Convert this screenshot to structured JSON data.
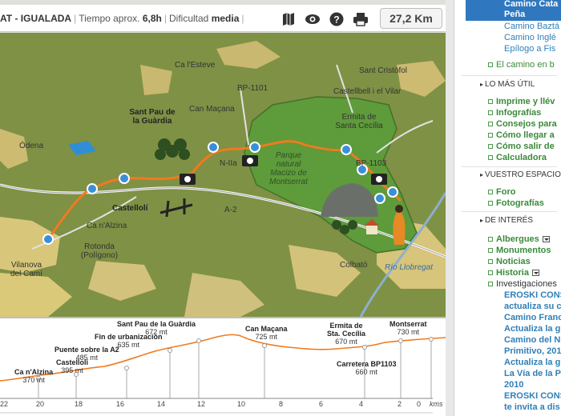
{
  "header": {
    "route_name": "AT - IGUALADA",
    "time_label": "Tiempo aprox.",
    "time_value": "6,8h",
    "difficulty_label": "Dificultad",
    "difficulty_value": "media",
    "distance": "27,2 Km",
    "icons": [
      "map-icon",
      "eye-icon",
      "help-icon",
      "print-icon"
    ]
  },
  "map": {
    "towns": [
      "Ca l'Esteve",
      "BP-1101",
      "Sant Cristòfol",
      "Castellbell i el Vilar",
      "Ermita de Santa Cecília",
      "Sant Pau de la Guàrdia",
      "Can Maçana",
      "Ódena",
      "BP-1103",
      "Castellolí",
      "N-IIa",
      "Ca n'Alzina",
      "Rotonda (Polígono)",
      "A-2",
      "Vilanova del Camí",
      "Colbató",
      "Río Llobregat"
    ],
    "park_label": "Parque natural Macizo de Montserrat"
  },
  "elevation": {
    "points": [
      {
        "name": "Ca n'Alzina",
        "alt": "370 mt"
      },
      {
        "name": "Castellolí",
        "alt": "395 mt"
      },
      {
        "name": "Puente sobre la A2",
        "alt": "485 mt"
      },
      {
        "name": "Fin de urbanización",
        "alt": "635 mt"
      },
      {
        "name": "Sant Pau de la Guàrdia",
        "alt": "672 mt"
      },
      {
        "name": "Can Maçana",
        "alt": "725 mt"
      },
      {
        "name": "Ermita de Sta. Cecília",
        "alt": "670 mt"
      },
      {
        "name": "Carretera BP1103",
        "alt": "660 mt"
      },
      {
        "name": "Montserrat",
        "alt": "730 mt"
      }
    ],
    "km_ticks": [
      "22",
      "20",
      "18",
      "16",
      "14",
      "12",
      "10",
      "8",
      "6",
      "4",
      "2",
      "0"
    ],
    "km_unit": "kms"
  },
  "sidebar": {
    "highlight_lines": [
      "Camino Cata",
      "Peña"
    ],
    "top_links": [
      "Camino Baztá",
      "Camino Inglé",
      "Epílogo a Fis"
    ],
    "el_camino": "El camino en b",
    "lo_mas_util": {
      "heading": "LO MÁS ÚTIL",
      "items": [
        "Imprime y llév",
        "Infografías",
        "Consejos para",
        "Cómo llegar a",
        "Cómo salir de",
        "Calculadora"
      ]
    },
    "vuestro": {
      "heading": "VUESTRO ESPACIO",
      "items": [
        "Foro",
        "Fotografías"
      ]
    },
    "de_interes": {
      "heading": "DE INTERÉS",
      "items": [
        "Albergues",
        "Monumentos",
        "Noticias",
        "Historia",
        "Investigaciones"
      ],
      "sub_links": [
        "EROSKI CONS",
        "actualiza su c",
        "Camino Franc",
        "Actualiza la g",
        "Camino del N",
        "Primitivo, 201",
        "Actualiza la g",
        "La Vía de la P",
        "2010",
        "EROSKI CONS",
        "te invita a dis"
      ]
    }
  }
}
